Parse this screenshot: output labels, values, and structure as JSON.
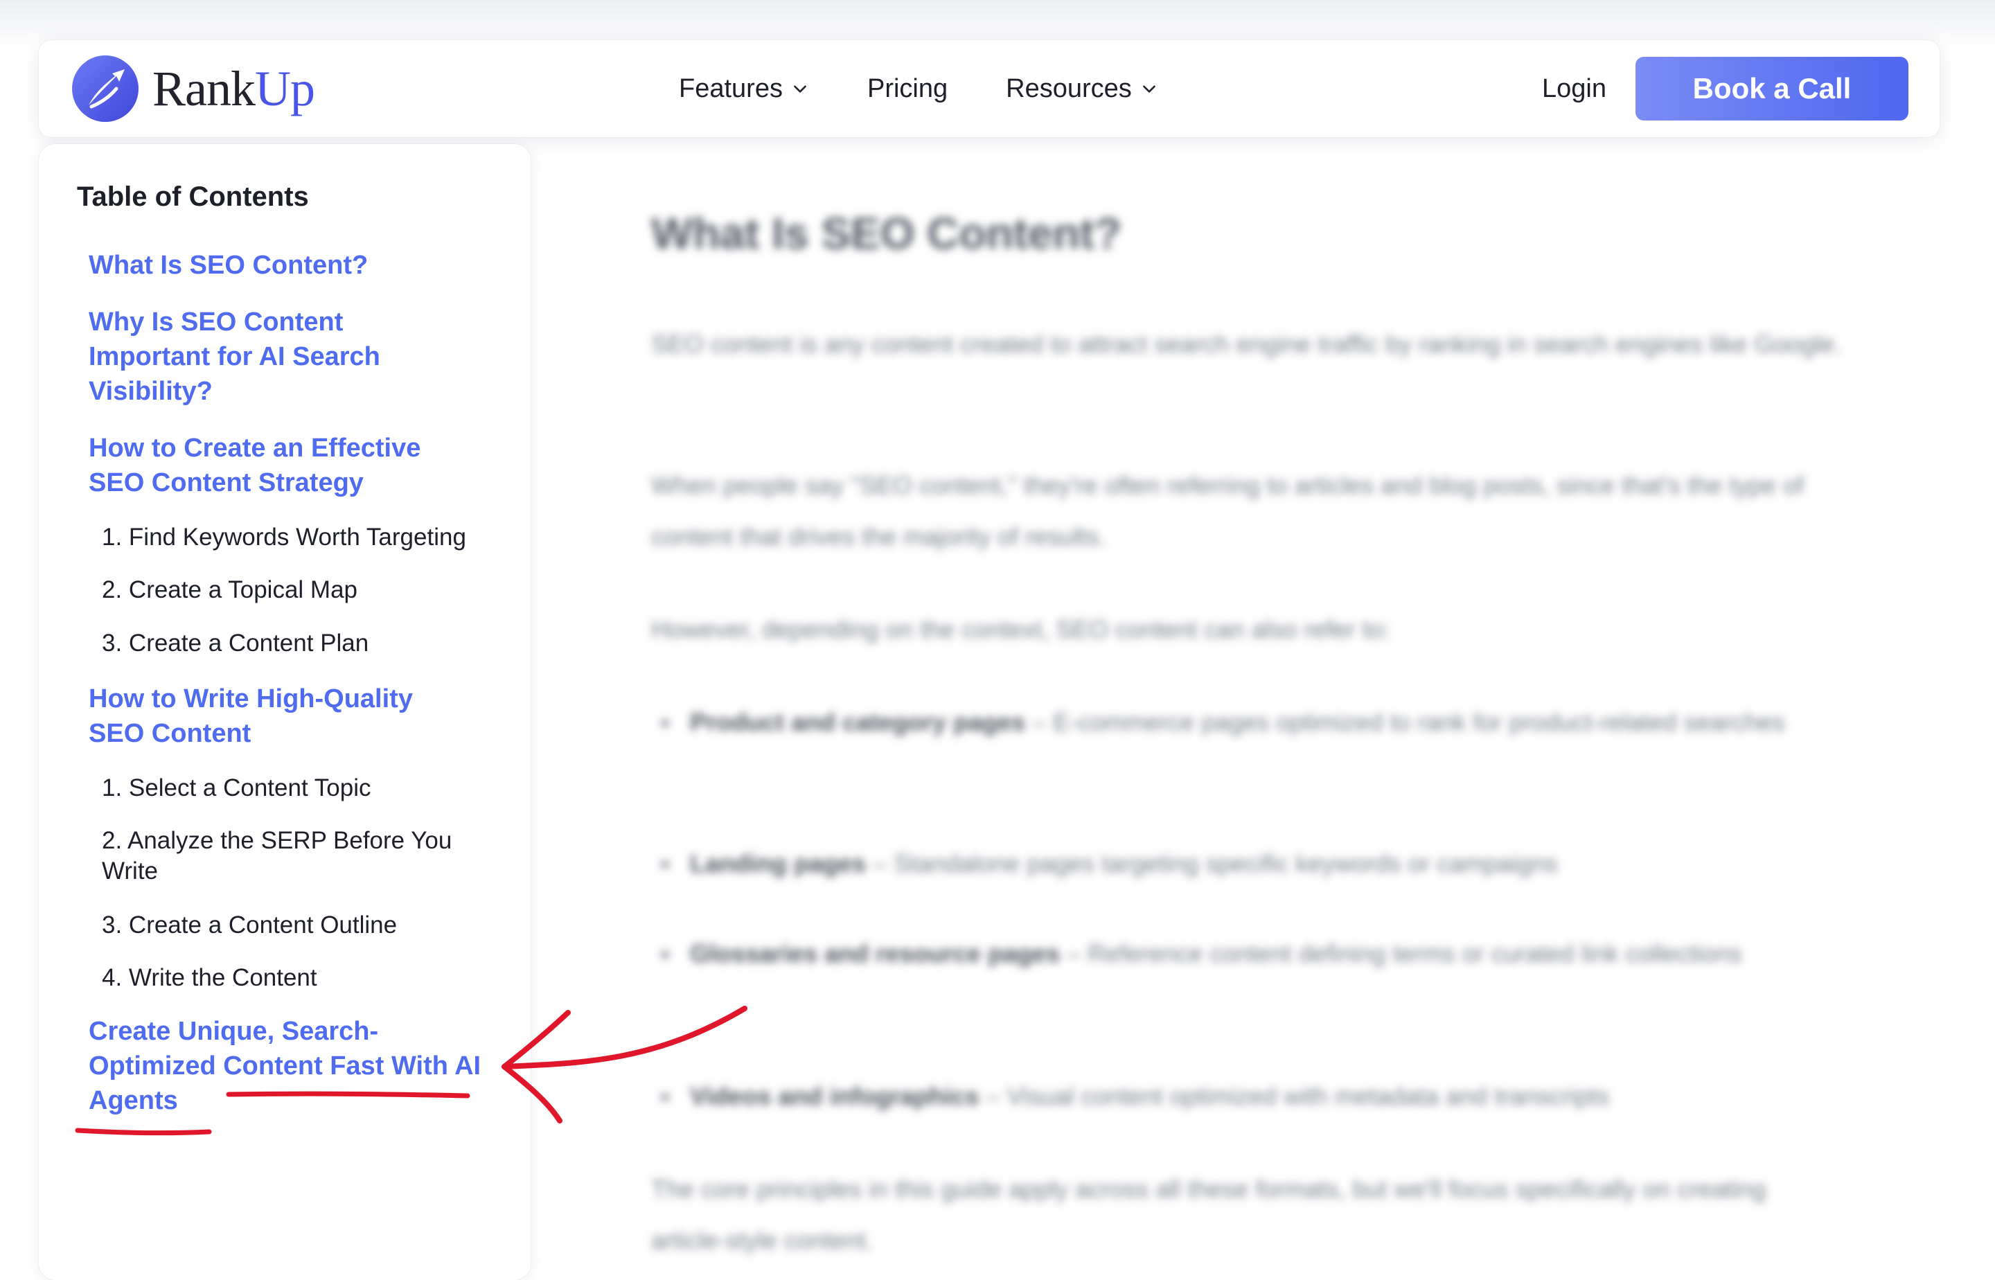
{
  "brand": {
    "name_part1": "Rank",
    "name_part2": "Up"
  },
  "nav": {
    "items": [
      {
        "label": "Features",
        "has_dropdown": true
      },
      {
        "label": "Pricing",
        "has_dropdown": false
      },
      {
        "label": "Resources",
        "has_dropdown": true
      }
    ],
    "login_label": "Login",
    "cta_label": "Book a Call"
  },
  "toc": {
    "title": "Table of Contents",
    "entries": [
      {
        "level": 1,
        "label": "What Is SEO Content?"
      },
      {
        "level": 1,
        "label": "Why Is SEO Content Important for AI Search Visibility?"
      },
      {
        "level": 1,
        "label": "How to Create an Effective SEO Content Strategy"
      },
      {
        "level": 2,
        "label": "1. Find Keywords Worth Targeting"
      },
      {
        "level": 2,
        "label": "2. Create a Topical Map"
      },
      {
        "level": 2,
        "label": "3. Create a Content Plan"
      },
      {
        "level": 1,
        "label": "How to Write High-Quality SEO Content"
      },
      {
        "level": 2,
        "label": "1. Select a Content Topic"
      },
      {
        "level": 2,
        "label": "2. Analyze the SERP Before You Write"
      },
      {
        "level": 2,
        "label": "3. Create a Content Outline"
      },
      {
        "level": 2,
        "label": "4. Write the Content"
      },
      {
        "level": 1,
        "label": "Create Unique, Search-Optimized Content Fast With AI Agents",
        "highlighted": true
      }
    ]
  },
  "article": {
    "heading": "What Is SEO Content?",
    "paragraphs": [
      "SEO content is any content created to attract search engine traffic by ranking in search engines like Google.",
      "When people say \"SEO content,\" they're often referring to articles and blog posts, since that's the type of content that drives the majority of results.",
      "However, depending on the context, SEO content can also refer to:"
    ],
    "bullets": [
      {
        "term": "Product and category pages",
        "text": " – E-commerce pages optimized to rank for product-related searches"
      },
      {
        "term": "Landing pages",
        "text": " – Standalone pages targeting specific keywords or campaigns"
      },
      {
        "term": "Glossaries and resource pages",
        "text": " – Reference content defining terms or curated link collections"
      },
      {
        "term": "Videos and infographics",
        "text": " – Visual content optimized with metadata and transcripts"
      }
    ],
    "closing": "The core principles in this guide apply across all these formats, but we'll focus specifically on creating article-style content."
  },
  "colors": {
    "link_blue": "#4f6bf0",
    "cta_gradient_start": "#7b8cf6",
    "cta_gradient_end": "#4f66ef",
    "annotation_red": "#e0162b"
  },
  "icons": {
    "logo": "rankup-star-logo-icon",
    "dropdown": "chevron-down-icon",
    "annotation": "red-arrow-annotation-icon"
  }
}
